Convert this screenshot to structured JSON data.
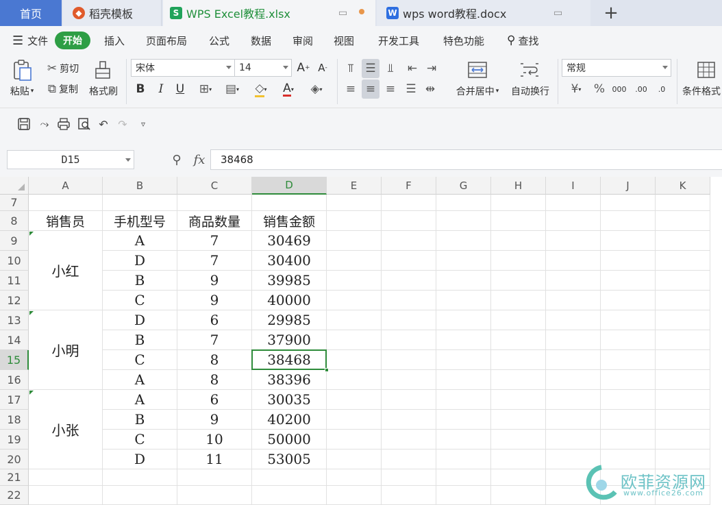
{
  "tabs": [
    {
      "label": "首页",
      "icon": "home-tab"
    },
    {
      "label": "稻壳模板",
      "icon": "docer-icon"
    },
    {
      "label": "WPS Excel教程.xlsx",
      "icon": "sheet-file-icon"
    },
    {
      "label": "wps word教程.docx",
      "icon": "word-file-icon"
    }
  ],
  "menu": {
    "file": "文件",
    "items": [
      "开始",
      "插入",
      "页面布局",
      "公式",
      "数据",
      "审阅",
      "视图",
      "开发工具",
      "特色功能"
    ],
    "search": "查找"
  },
  "ribbon": {
    "paste": "粘贴",
    "cut": "剪切",
    "copy": "复制",
    "format_painter": "格式刷",
    "font": "宋体",
    "size": "14",
    "merge": "合并居中",
    "wrap": "自动换行",
    "number_format": "常规",
    "cond_format": "条件格式"
  },
  "formula_bar": {
    "name_box": "D15",
    "fx": "fx",
    "value": "38468"
  },
  "columns": [
    "A",
    "B",
    "C",
    "D",
    "E",
    "F",
    "G",
    "H",
    "I",
    "J",
    "K"
  ],
  "rows": [
    "7",
    "8",
    "9",
    "10",
    "11",
    "12",
    "13",
    "14",
    "15",
    "16",
    "17",
    "18",
    "19",
    "20",
    "21",
    "22"
  ],
  "header_row": [
    "销售员",
    "手机型号",
    "商品数量",
    "销售金额"
  ],
  "groups": [
    {
      "name": "小红",
      "items": [
        [
          "A",
          "7",
          "30469"
        ],
        [
          "D",
          "7",
          "30400"
        ],
        [
          "B",
          "9",
          "39985"
        ],
        [
          "C",
          "9",
          "40000"
        ]
      ]
    },
    {
      "name": "小明",
      "items": [
        [
          "D",
          "6",
          "29985"
        ],
        [
          "B",
          "7",
          "37900"
        ],
        [
          "C",
          "8",
          "38468"
        ],
        [
          "A",
          "8",
          "38396"
        ]
      ]
    },
    {
      "name": "小张",
      "items": [
        [
          "A",
          "6",
          "30035"
        ],
        [
          "B",
          "9",
          "40200"
        ],
        [
          "C",
          "10",
          "50000"
        ],
        [
          "D",
          "11",
          "53005"
        ]
      ]
    }
  ],
  "selected": {
    "cell": "D15",
    "color": "#2e8b3a"
  },
  "watermark": {
    "title": "欧菲资源网",
    "url": "www.office26.com"
  },
  "colors": {
    "home_tab": "#4a78d2",
    "active_green": "#2e9e45",
    "word_blue": "#2f6fe0",
    "sheet_green": "#20a35a",
    "docer_red": "#e05a2b"
  }
}
